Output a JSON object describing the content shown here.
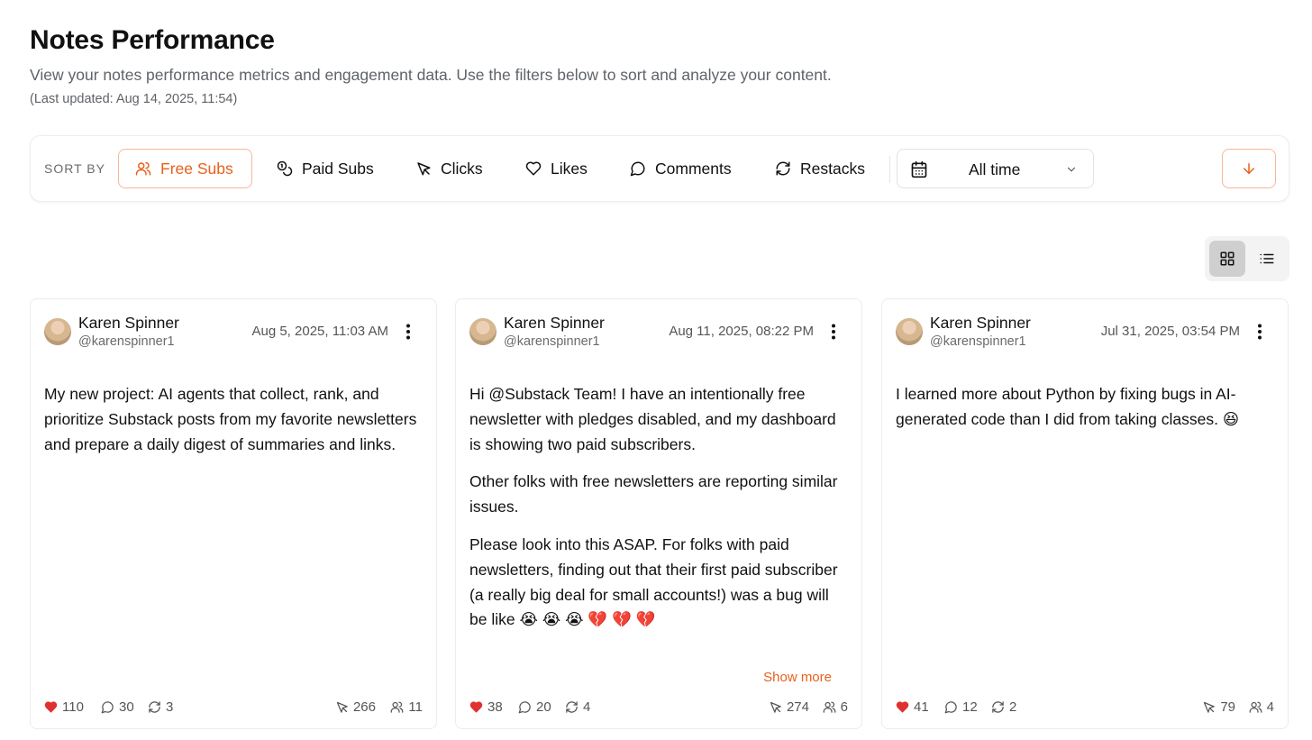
{
  "header": {
    "title": "Notes Performance",
    "subtitle": "View your notes performance metrics and engagement data. Use the filters below to sort and analyze your content.",
    "last_updated": "(Last updated: Aug 14, 2025, 11:54)"
  },
  "sort_bar": {
    "label": "SORT BY",
    "options": [
      {
        "label": "Free Subs",
        "icon": "users-icon",
        "active": true
      },
      {
        "label": "Paid Subs",
        "icon": "coins-icon",
        "active": false
      },
      {
        "label": "Clicks",
        "icon": "cursor-icon",
        "active": false
      },
      {
        "label": "Likes",
        "icon": "heart-icon",
        "active": false
      },
      {
        "label": "Comments",
        "icon": "comment-icon",
        "active": false
      },
      {
        "label": "Restacks",
        "icon": "restack-icon",
        "active": false
      }
    ],
    "date_range": {
      "value": "All time",
      "icon": "calendar-icon"
    },
    "sort_order_icon": "arrow-down-icon"
  },
  "view_toggle": {
    "active": "grid",
    "options": [
      "grid",
      "list"
    ]
  },
  "colors": {
    "accent": "#e8611c",
    "accent_border": "#f6b79a",
    "like_red": "#e03131"
  },
  "cards": [
    {
      "author": "Karen Spinner",
      "handle": "@karenspinner1",
      "date": "Aug 5, 2025, 11:03 AM",
      "paragraphs": [
        "My new project: AI agents that collect, rank, and prioritize Substack posts from my favorite newsletters and prepare a daily digest of summaries and links."
      ],
      "show_more": "",
      "likes": "110",
      "comments": "30",
      "restacks": "3",
      "clicks": "266",
      "subs": "11"
    },
    {
      "author": "Karen Spinner",
      "handle": "@karenspinner1",
      "date": "Aug 11, 2025, 08:22 PM",
      "paragraphs": [
        "Hi @Substack Team! I have an intentionally free newsletter with pledges disabled, and my dashboard is showing two paid subscribers.",
        "Other folks with free newsletters are reporting similar issues.",
        "Please look into this ASAP. For folks with paid newsletters, finding out that their first paid subscriber (a really big deal for small accounts!) was a bug will be like 😭 😭 😭 💔 💔 💔"
      ],
      "show_more": "Show more",
      "likes": "38",
      "comments": "20",
      "restacks": "4",
      "clicks": "274",
      "subs": "6"
    },
    {
      "author": "Karen Spinner",
      "handle": "@karenspinner1",
      "date": "Jul 31, 2025, 03:54 PM",
      "paragraphs": [
        "I learned more about Python by fixing bugs in AI-generated code than I did from taking classes. 😆"
      ],
      "show_more": "",
      "likes": "41",
      "comments": "12",
      "restacks": "2",
      "clicks": "79",
      "subs": "4"
    }
  ]
}
